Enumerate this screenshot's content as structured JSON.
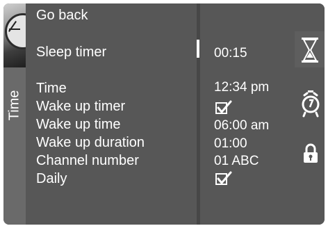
{
  "sidebar": {
    "tab_label": "Time",
    "image_icon": "clock-photo-icon"
  },
  "menu": {
    "items": [
      {
        "label": "Go back"
      },
      {
        "label": "Sleep timer"
      },
      {
        "label": "Time"
      },
      {
        "label": "Wake up timer"
      },
      {
        "label": "Wake up time"
      },
      {
        "label": "Wake up duration"
      },
      {
        "label": "Channel number"
      },
      {
        "label": "Daily"
      }
    ],
    "selected_index": 1
  },
  "values": {
    "sleep_timer": "00:15",
    "time": "12:34 pm",
    "wake_up_timer": true,
    "wake_up_time": "06:00 am",
    "wake_up_duration": "01:00",
    "channel_number": "01 ABC",
    "daily": true
  },
  "icons": [
    "hourglass-icon",
    "alarm-clock-icon",
    "padlock-icon",
    "checkmark-icon"
  ],
  "colors": {
    "background": "#555555",
    "text": "#ffffff",
    "divider": "#474747",
    "strip": "#6a6a6a"
  }
}
